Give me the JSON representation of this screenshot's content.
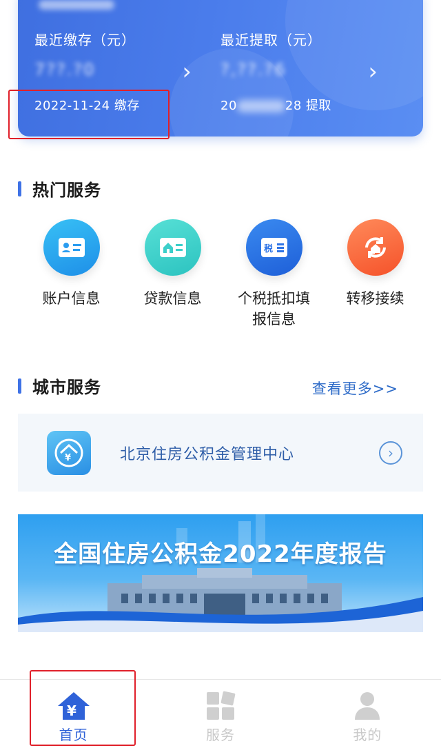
{
  "account_card": {
    "deposit": {
      "label": "最近缴存（元）",
      "amount": "7??.?0",
      "date": "2022-11-24 缴存"
    },
    "withdraw": {
      "label": "最近提取（元）",
      "amount": "?,??.?6",
      "date_prefix": "20",
      "date_suffix": "28 提取"
    }
  },
  "hot_services": {
    "title": "热门服务",
    "items": [
      {
        "label": "账户信息",
        "icon": "id-card-icon",
        "color": "#2a9cf0"
      },
      {
        "label": "贷款信息",
        "icon": "house-card-icon",
        "color": "#3ccfca"
      },
      {
        "label": "个税抵扣填报信息",
        "icon": "tax-card-icon",
        "color": "#2e74e6"
      },
      {
        "label": "转移接续",
        "icon": "transfer-icon",
        "color": "#f76a3c"
      }
    ]
  },
  "city_services": {
    "title": "城市服务",
    "more": "查看更多>>",
    "center_name": "北京住房公积金管理中心"
  },
  "banner": {
    "title": "全国住房公积金2022年度报告"
  },
  "tabbar": {
    "tabs": [
      {
        "label": "首页",
        "icon": "home-yen-icon",
        "active": true
      },
      {
        "label": "服务",
        "icon": "grid-icon",
        "active": false
      },
      {
        "label": "我的",
        "icon": "person-icon",
        "active": false
      }
    ]
  },
  "colors": {
    "accent": "#2f62d8",
    "card_blue": "#4a7ceb",
    "highlight_red": "#e0202a"
  }
}
